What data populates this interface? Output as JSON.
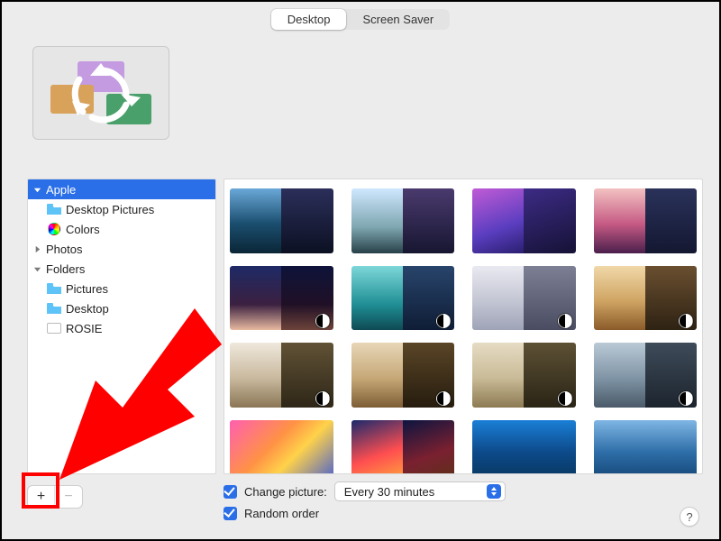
{
  "tabs": {
    "desktop": "Desktop",
    "screensaver": "Screen Saver",
    "active": "desktop"
  },
  "sidebar": {
    "apple": "Apple",
    "desktop_pictures": "Desktop Pictures",
    "colors": "Colors",
    "photos": "Photos",
    "folders": "Folders",
    "pictures": "Pictures",
    "desktop": "Desktop",
    "rosie": "ROSIE"
  },
  "controls": {
    "add": "+",
    "remove": "−",
    "change_picture_label": "Change picture:",
    "change_picture_value": "Every 30 minutes",
    "random_order_label": "Random order",
    "help": "?"
  },
  "thumbnails": [
    {
      "id": "catalina",
      "dynamic": false
    },
    {
      "id": "bigsur-coast",
      "dynamic": false
    },
    {
      "id": "bigsur-graphic-purple",
      "dynamic": false
    },
    {
      "id": "bigsur-graphic-pink",
      "dynamic": false
    },
    {
      "id": "iridescence",
      "dynamic": true
    },
    {
      "id": "beach",
      "dynamic": true
    },
    {
      "id": "dome",
      "dynamic": true
    },
    {
      "id": "cliffs",
      "dynamic": true
    },
    {
      "id": "desert",
      "dynamic": true
    },
    {
      "id": "tree",
      "dynamic": true
    },
    {
      "id": "valley",
      "dynamic": true
    },
    {
      "id": "lake",
      "dynamic": true
    },
    {
      "id": "bigsur-color",
      "dynamic": false
    },
    {
      "id": "bigsur-abstract",
      "dynamic": false
    },
    {
      "id": "bigsur-aerial",
      "dynamic": false
    },
    {
      "id": "bigsur-aerial2",
      "dynamic": false
    }
  ]
}
